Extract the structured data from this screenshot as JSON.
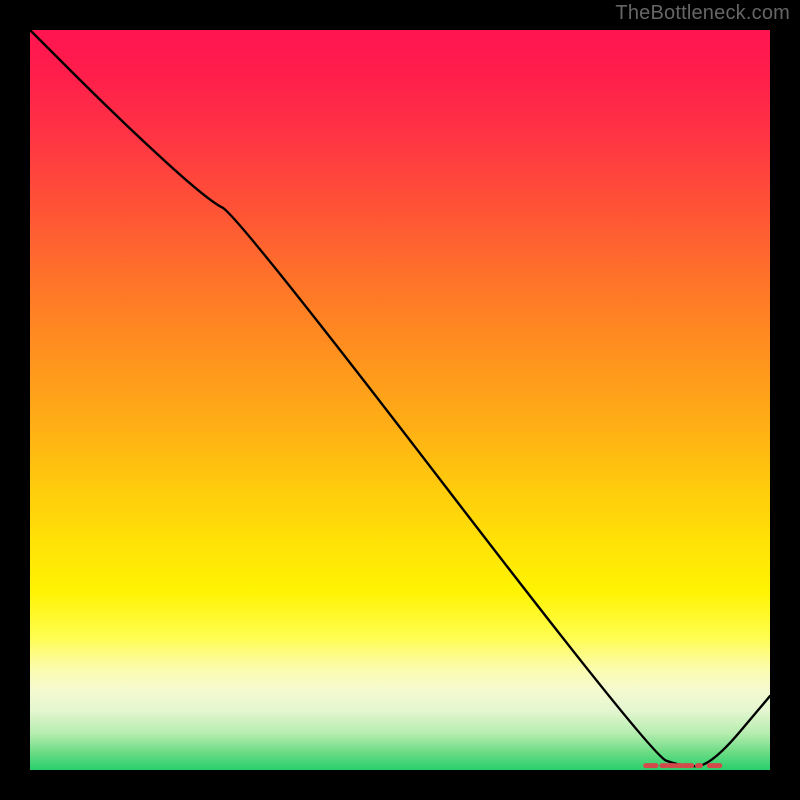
{
  "watermark": "TheBottleneck.com",
  "chart_data": {
    "type": "line",
    "title": "",
    "xlabel": "",
    "ylabel": "",
    "xlim": [
      0,
      100
    ],
    "ylim": [
      0,
      100
    ],
    "series": [
      {
        "name": "curve",
        "x": [
          0,
          12,
          24,
          28,
          84,
          88,
          92,
          100
        ],
        "y": [
          100,
          88,
          77,
          75,
          2,
          0.5,
          0.5,
          10
        ]
      }
    ],
    "flat_segment": {
      "x0": 84,
      "x1": 92,
      "y": 0.6
    },
    "dashes": {
      "y": 0.6,
      "segments": [
        {
          "x0": 83.2,
          "x1": 84.6
        },
        {
          "x0": 85.4,
          "x1": 86.0
        },
        {
          "x0": 86.4,
          "x1": 87.0
        },
        {
          "x0": 87.4,
          "x1": 88.0
        },
        {
          "x0": 88.4,
          "x1": 89.4
        },
        {
          "x0": 90.2,
          "x1": 90.6
        },
        {
          "x0": 91.8,
          "x1": 93.2
        }
      ],
      "color": "#d24a4a"
    },
    "gradient_stops": [
      {
        "pos": 0.0,
        "color": "#ff1450"
      },
      {
        "pos": 0.5,
        "color": "#ffa81a"
      },
      {
        "pos": 0.78,
        "color": "#fffb20"
      },
      {
        "pos": 0.88,
        "color": "#f8fac8"
      },
      {
        "pos": 1.0,
        "color": "#28cf6d"
      }
    ]
  }
}
